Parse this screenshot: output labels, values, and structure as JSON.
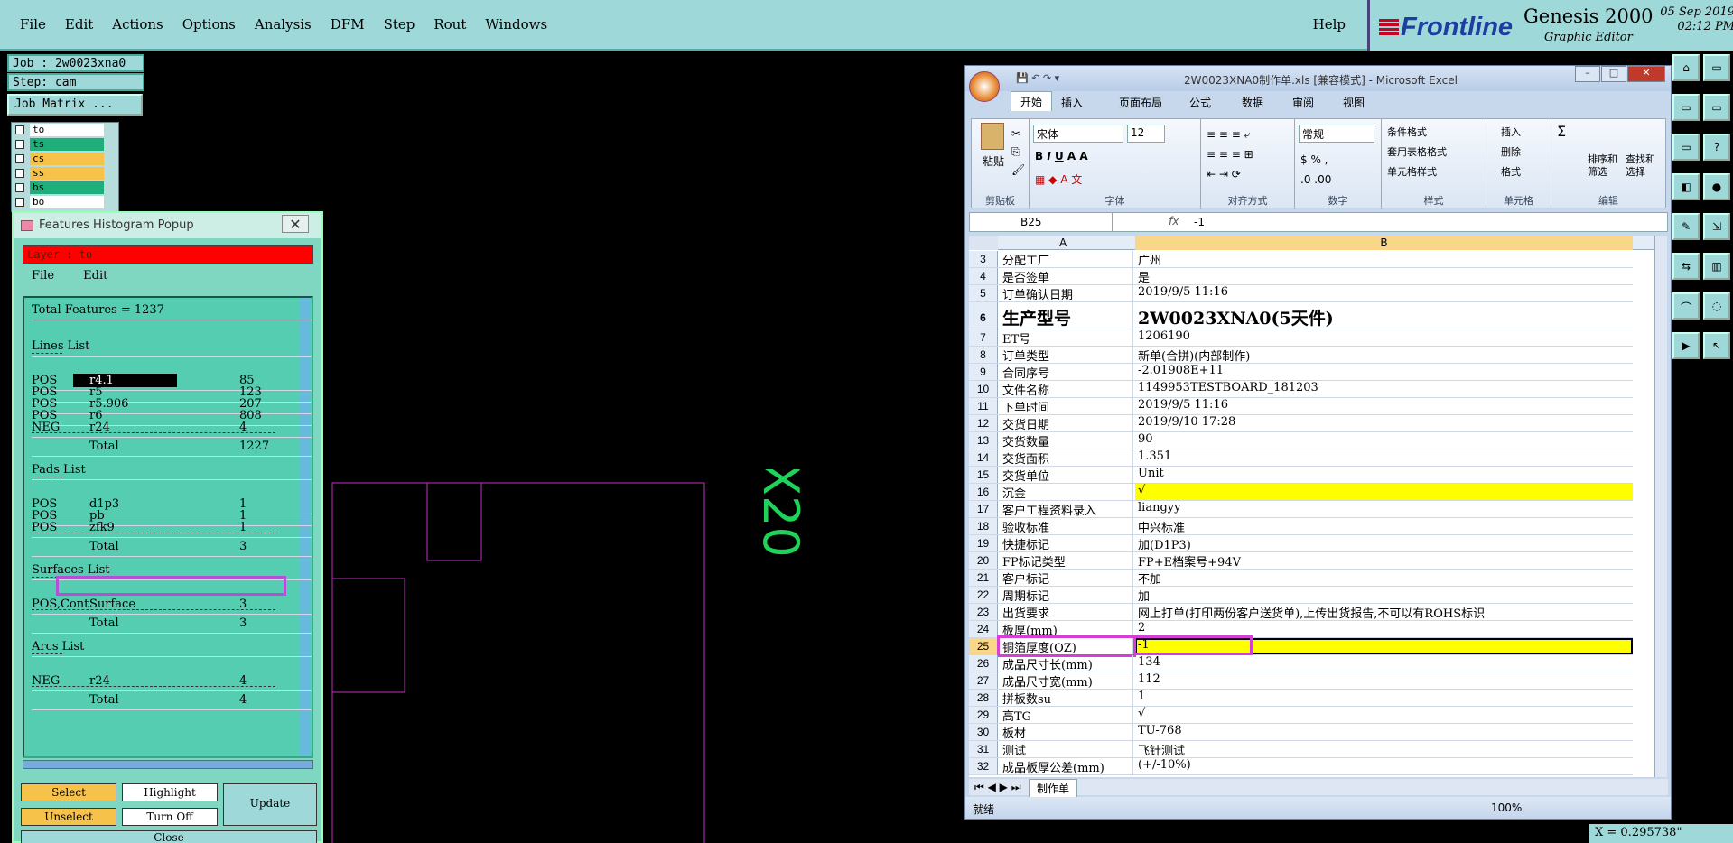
{
  "menu": {
    "items": [
      "File",
      "Edit",
      "Actions",
      "Options",
      "Analysis",
      "DFM",
      "Step",
      "Rout",
      "Windows"
    ],
    "help": "Help"
  },
  "brand": {
    "logo": "Frontline",
    "product": "Genesis 2000",
    "subtitle": "Graphic Editor",
    "date": "05 Sep 2019",
    "time": "02:12 PM"
  },
  "job": {
    "job": "Job : 2w0023xna0",
    "step": "Step: cam",
    "matrix_btn": "Job Matrix ..."
  },
  "layers": [
    {
      "name": "to",
      "color": "#ffffff"
    },
    {
      "name": "ts",
      "color": "#1fae7a"
    },
    {
      "name": "cs",
      "color": "#f6c24a"
    },
    {
      "name": "ss",
      "color": "#f6c24a"
    },
    {
      "name": "bs",
      "color": "#1fae7a"
    },
    {
      "name": "bo",
      "color": "#ffffff"
    }
  ],
  "popup": {
    "title": "Features Histogram Popup",
    "layer": "Layer :  to",
    "menu": [
      "File",
      "Edit"
    ],
    "total": "Total Features = 1237",
    "lines_title": "Lines List",
    "lines": [
      {
        "pol": "POS",
        "sym": "r4.1",
        "cnt": "85"
      },
      {
        "pol": "POS",
        "sym": "r5",
        "cnt": "123"
      },
      {
        "pol": "POS",
        "sym": "r5.906",
        "cnt": "207"
      },
      {
        "pol": "POS",
        "sym": "r6",
        "cnt": "808"
      },
      {
        "pol": "NEG",
        "sym": "r24",
        "cnt": "4"
      }
    ],
    "lines_total": "1227",
    "pads_title": "Pads List",
    "pads": [
      {
        "pol": "POS",
        "sym": "d1p3",
        "cnt": "1"
      },
      {
        "pol": "POS",
        "sym": "pb",
        "cnt": "1"
      },
      {
        "pol": "POS",
        "sym": "zfk9",
        "cnt": "1"
      }
    ],
    "pads_total": "3",
    "surf_title": "Surfaces List",
    "surf": [
      {
        "pol": "POS,Cont",
        "sym": "Surface",
        "cnt": "3"
      }
    ],
    "surf_total": "3",
    "arcs_title": "Arcs List",
    "arcs": [
      {
        "pol": "NEG",
        "sym": "r24",
        "cnt": "4"
      }
    ],
    "arcs_total": "4",
    "total_label": "Total",
    "buttons": {
      "select": "Select",
      "highlight": "Highlight",
      "update": "Update",
      "unselect": "Unselect",
      "turnoff": "Turn Off",
      "close": "Close"
    }
  },
  "canvas": {
    "label": "X20"
  },
  "excel": {
    "title": "2W0023XNA0制作单.xls  [兼容模式] - Microsoft Excel",
    "tabs": [
      "开始",
      "插入",
      "页面布局",
      "公式",
      "数据",
      "审阅",
      "视图"
    ],
    "font": "宋体",
    "size": "12",
    "numfmt": "常规",
    "groups": [
      "剪贴板",
      "字体",
      "对齐方式",
      "数字",
      "样式",
      "单元格",
      "编辑"
    ],
    "paste": "粘贴",
    "style_items": [
      "条件格式",
      "套用表格格式",
      "单元格样式"
    ],
    "cell_items": [
      "插入",
      "删除",
      "格式"
    ],
    "edit_items": [
      "排序和\n筛选",
      "查找和\n选择"
    ],
    "namebox": "B25",
    "formula": "-1",
    "col_a": "A",
    "col_b": "B",
    "rows": [
      {
        "n": "3",
        "a": "分配工厂",
        "b": "广州"
      },
      {
        "n": "4",
        "a": "是否签单",
        "b": "是"
      },
      {
        "n": "5",
        "a": "订单确认日期",
        "b": "2019/9/5 11:16"
      },
      {
        "n": "6",
        "a": "生产型号",
        "b": "2W0023XNA0(5天件)",
        "big": true
      },
      {
        "n": "7",
        "a": "ET号",
        "b": "1206190"
      },
      {
        "n": "8",
        "a": "订单类型",
        "b": "新单(合拼)(内部制作)"
      },
      {
        "n": "9",
        "a": "合同序号",
        "b": "-2.01908E+11"
      },
      {
        "n": "10",
        "a": "文件名称",
        "b": "1149953TESTBOARD_181203"
      },
      {
        "n": "11",
        "a": "下单时间",
        "b": "2019/9/5 11:16"
      },
      {
        "n": "12",
        "a": "交货日期",
        "b": "2019/9/10 17:28"
      },
      {
        "n": "13",
        "a": "交货数量",
        "b": "90"
      },
      {
        "n": "14",
        "a": "交货面积",
        "b": "1.351"
      },
      {
        "n": "15",
        "a": "交货单位",
        "b": "Unit"
      },
      {
        "n": "16",
        "a": "沉金",
        "b": "√",
        "hl": true
      },
      {
        "n": "17",
        "a": "客户工程资料录入",
        "b": "liangyy"
      },
      {
        "n": "18",
        "a": "验收标准",
        "b": "中兴标准"
      },
      {
        "n": "19",
        "a": "快捷标记",
        "b": "加(D1P3)"
      },
      {
        "n": "20",
        "a": "FP标记类型",
        "b": "FP+E档案号+94V"
      },
      {
        "n": "21",
        "a": "客户标记",
        "b": "不加"
      },
      {
        "n": "22",
        "a": "周期标记",
        "b": "加"
      },
      {
        "n": "23",
        "a": "出货要求",
        "b": "网上打单(打印两份客户送货单),上传出货报告,不可以有ROHS标识"
      },
      {
        "n": "24",
        "a": "板厚(mm)",
        "b": "2"
      },
      {
        "n": "25",
        "a": "铜箔厚度(OZ)",
        "b": "-1",
        "hl": true
      },
      {
        "n": "26",
        "a": "成品尺寸长(mm)",
        "b": "134"
      },
      {
        "n": "27",
        "a": "成品尺寸宽(mm)",
        "b": "112"
      },
      {
        "n": "28",
        "a": "拼板数su",
        "b": "1"
      },
      {
        "n": "29",
        "a": "高TG",
        "b": "√"
      },
      {
        "n": "30",
        "a": "板材",
        "b": "TU-768"
      },
      {
        "n": "31",
        "a": "测试",
        "b": "飞针测试"
      },
      {
        "n": "32",
        "a": "成品板厚公差(mm)",
        "b": "(+/-10%)"
      }
    ],
    "sheet_tab": "制作单",
    "status": "就绪",
    "zoom": "100%"
  },
  "coord": "X = 0.295738\""
}
